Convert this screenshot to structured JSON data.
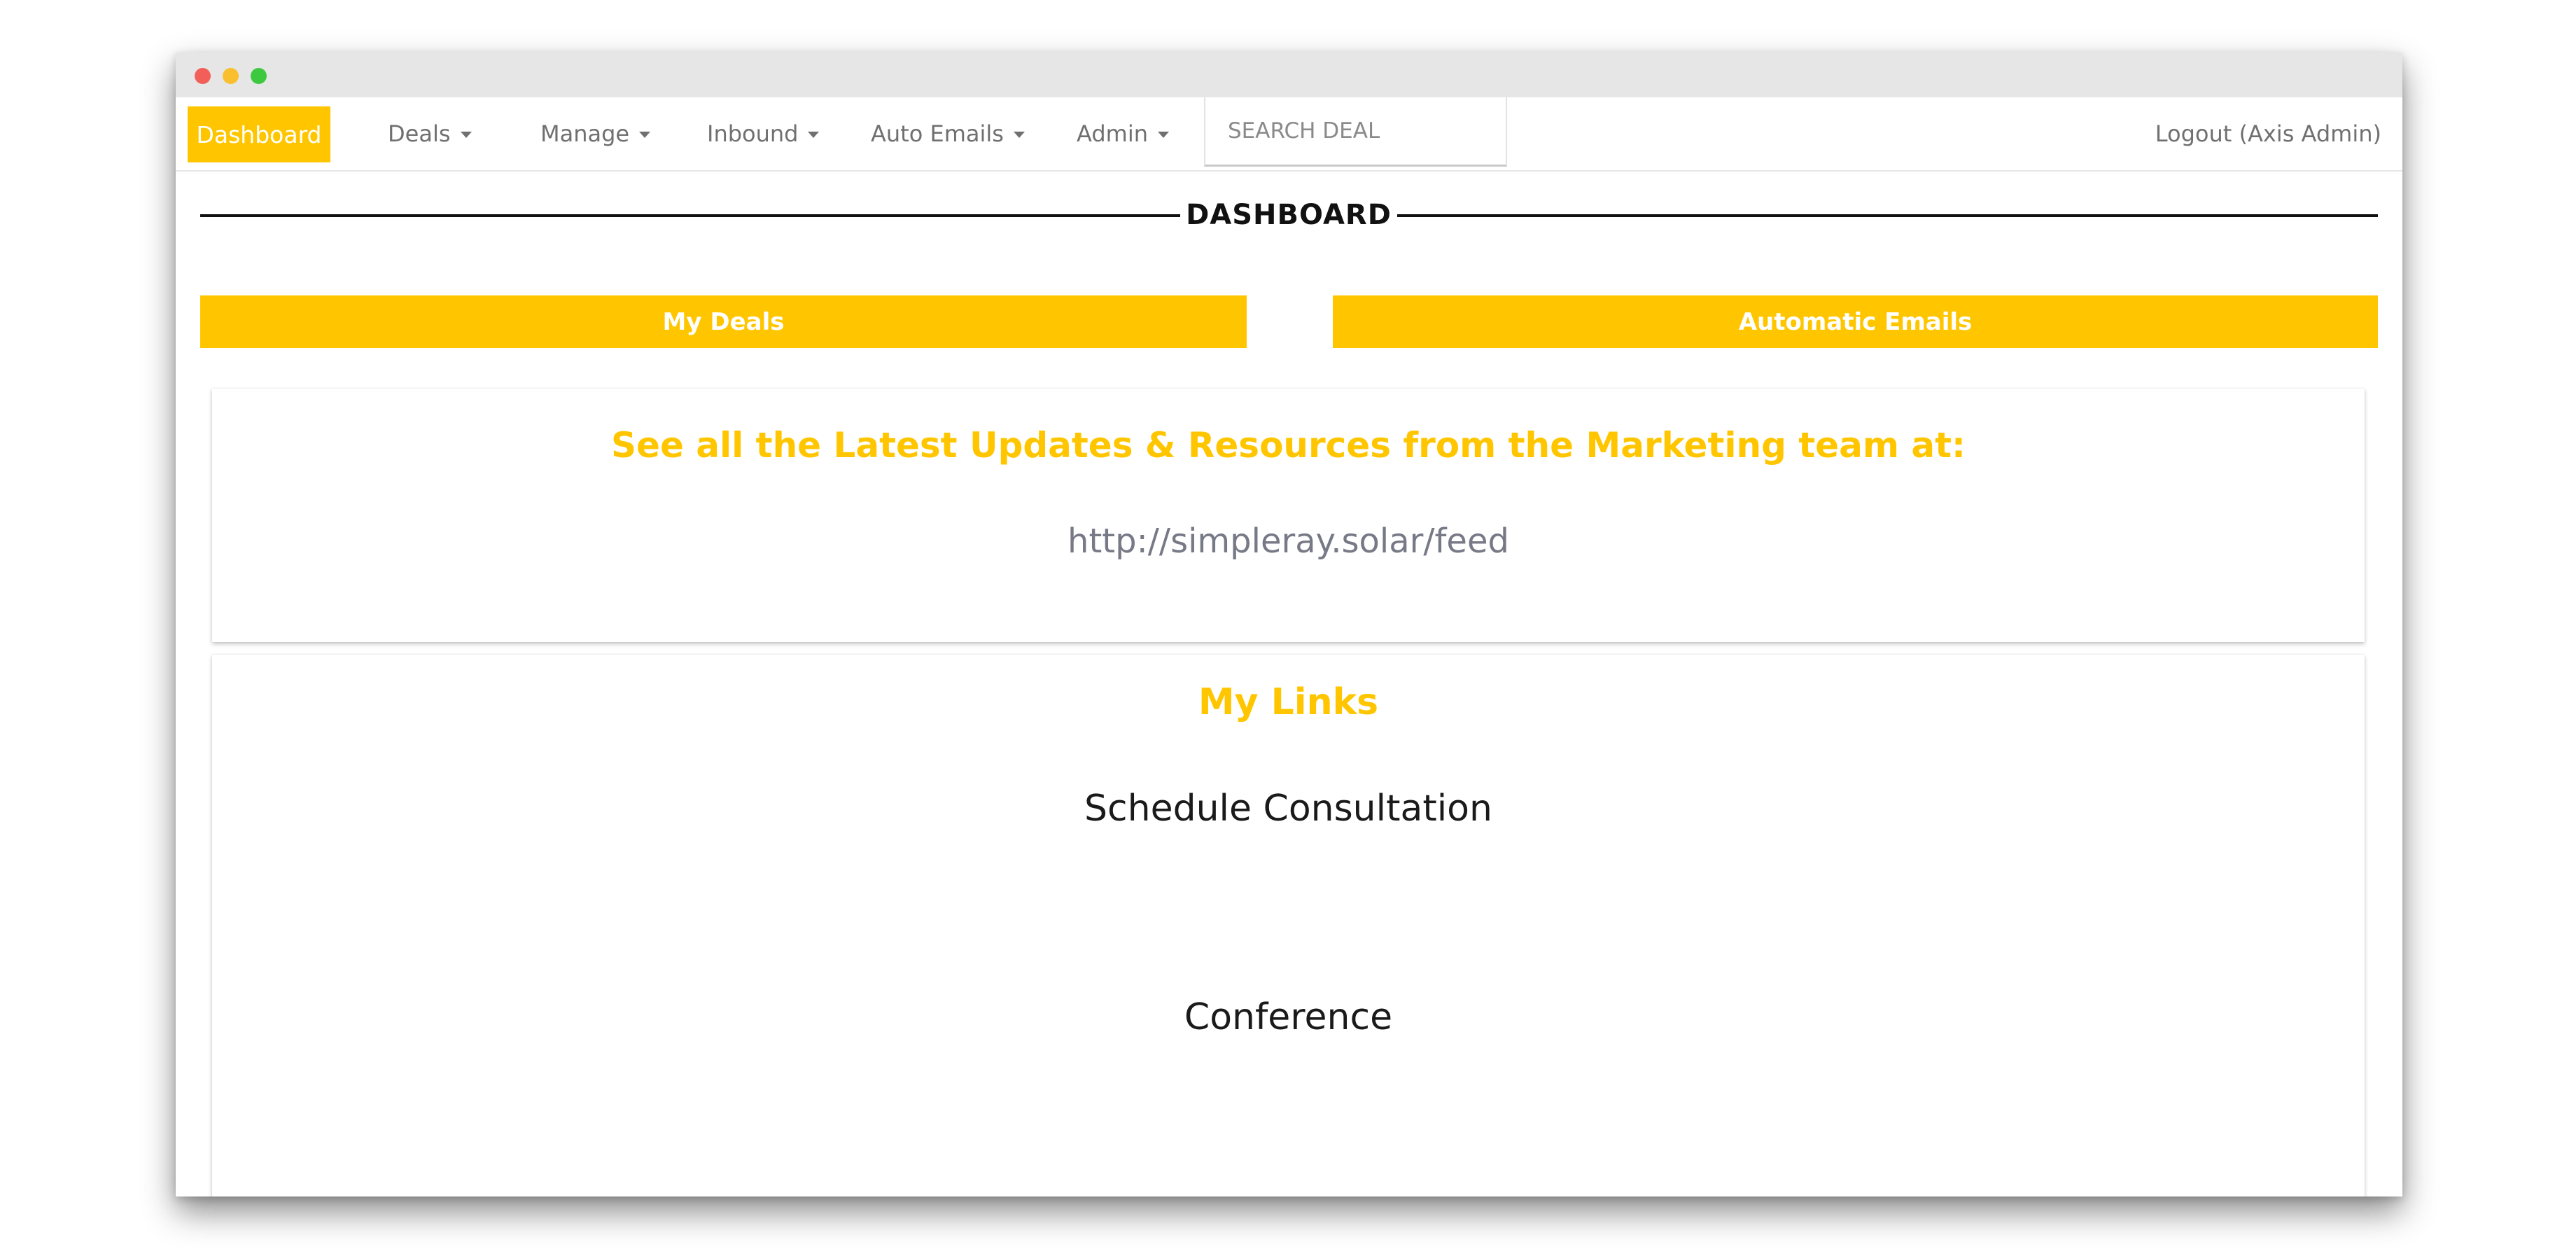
{
  "window": {
    "traffic_lights": [
      "close",
      "minimize",
      "maximize"
    ]
  },
  "nav": {
    "active": "Dashboard",
    "items": [
      {
        "label": "Deals"
      },
      {
        "label": "Manage"
      },
      {
        "label": "Inbound"
      },
      {
        "label": "Auto Emails"
      },
      {
        "label": "Admin"
      }
    ],
    "search_placeholder": "SEARCH DEAL",
    "logout": "Logout (Axis Admin)"
  },
  "page": {
    "title": "DASHBOARD"
  },
  "buttons": {
    "my_deals": "My Deals",
    "automatic_emails": "Automatic Emails"
  },
  "updates": {
    "title": "See all the Latest Updates & Resources from the Marketing team at:",
    "link": "http://simpleray.solar/feed"
  },
  "links": {
    "title": "My Links",
    "items": [
      {
        "label": "Schedule Consultation"
      },
      {
        "label": "Conference"
      }
    ]
  },
  "colors": {
    "accent": "#ffc600",
    "text_muted": "#707070",
    "heading": "#111111"
  }
}
